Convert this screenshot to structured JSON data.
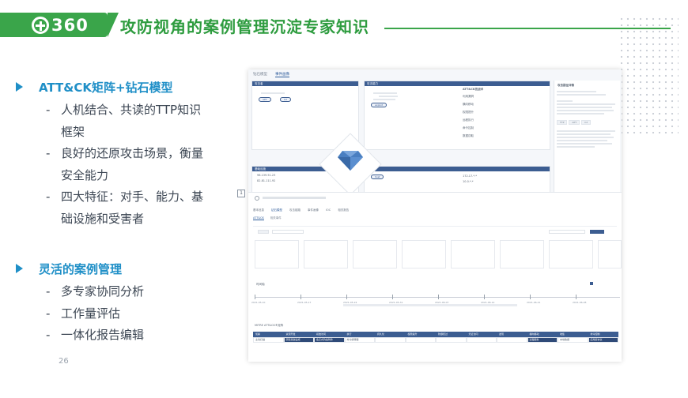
{
  "header": {
    "logo_text": "360",
    "title": "攻防视角的案例管理沉淀专家知识",
    "brand_color": "#3aa54a",
    "title_color": "#2e9c3f"
  },
  "sections": [
    {
      "title": "ATT&CK矩阵+钻石模型",
      "bullets": [
        "人机结合、共读的TTP知识框架",
        "良好的还原攻击场景，衡量安全能力",
        "四大特征：对手、能力、基础设施和受害者"
      ]
    },
    {
      "title": "灵活的案例管理",
      "bullets": [
        "多专家协同分析",
        "工作量评估",
        "一体化报告编辑"
      ]
    }
  ],
  "page_number": "26",
  "screenshot": {
    "tabs": [
      "钻石模型",
      "事件画像"
    ],
    "cards": {
      "adversary": "攻击者",
      "capability": "攻击能力",
      "infrastructure": "基础设施",
      "victim": "受害者",
      "attck": "ATT&CK技战术",
      "detail": "攻击路径详情"
    },
    "capability_items": [
      "利用漏洞",
      "横向移动",
      "权限提升",
      "远程执行",
      "命令控制",
      "数据窃取"
    ],
    "infra_items": [
      "98.139.51.23",
      "82.81.111.92"
    ],
    "victim_items": [
      "172.17.*.*",
      "10.0.*.*"
    ],
    "marker": "1",
    "case_tabs": [
      "基本信息",
      "钻石模型",
      "攻击链路",
      "事件画像",
      "IOC",
      "相关报告"
    ],
    "subtabs": [
      "ATT&CK",
      "相关事件"
    ],
    "timeline_label": "时间轴",
    "timeline_dates": [
      "2021-05-10",
      "2021-05-17",
      "2021-05-24",
      "2021-05-31",
      "2021-06-07",
      "2021-06-14",
      "2021-06-21",
      "2021-06-28"
    ],
    "grid_title": "MITRE ATT&CK®矩阵",
    "grid_headers": [
      "侦察",
      "资源开发",
      "初始访问",
      "执行",
      "持久化",
      "权限提升",
      "防御绕过",
      "凭证访问",
      "发现",
      "横向移动",
      "收集",
      "命令控制"
    ],
    "grid_row": [
      "主动扫描",
      "获取基础设施",
      "鱼叉式钓鱼附件",
      "命令解释器",
      "",
      "",
      "",
      "",
      "",
      "远程服务",
      "本地数据",
      "应用层协议"
    ]
  }
}
